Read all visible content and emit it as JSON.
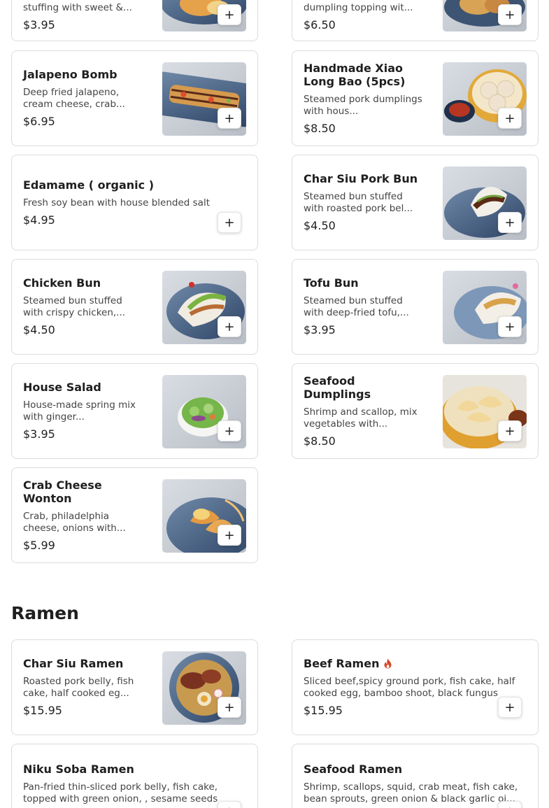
{
  "add_label": "+",
  "sections": {
    "ramen_title": "Ramen"
  },
  "items": {
    "top_left": {
      "desc": "stuffing with sweet &...",
      "price": "$3.95"
    },
    "top_right": {
      "desc": "dumpling topping wit...",
      "price": "$6.50"
    },
    "jalapeno": {
      "name": "Jalapeno Bomb",
      "desc": "Deep fried jalapeno, cream cheese, crab...",
      "price": "$6.95"
    },
    "xiaolongbao": {
      "name": "Handmade Xiao Long Bao (5pcs)",
      "desc": "Steamed pork dumplings with hous...",
      "price": "$8.50"
    },
    "edamame": {
      "name": "Edamame ( organic )",
      "desc": "Fresh soy bean with house blended salt",
      "price": "$4.95"
    },
    "charsiu_bun": {
      "name": "Char Siu Pork Bun",
      "desc": "Steamed bun stuffed with roasted pork bel...",
      "price": "$4.50"
    },
    "chicken_bun": {
      "name": "Chicken Bun",
      "desc": "Steamed bun stuffed with crispy chicken,...",
      "price": "$4.50"
    },
    "tofu_bun": {
      "name": "Tofu Bun",
      "desc": "Steamed bun stuffed with deep-fried tofu,...",
      "price": "$3.95"
    },
    "house_salad": {
      "name": "House Salad",
      "desc": "House-made spring mix with ginger...",
      "price": "$3.95"
    },
    "seafood_dumplings": {
      "name": "Seafood Dumplings",
      "desc": "Shrimp and scallop, mix vegetables with...",
      "price": "$8.50"
    },
    "crab_wonton": {
      "name": "Crab Cheese Wonton",
      "desc": "Crab, philadelphia cheese, onions with...",
      "price": "$5.99"
    },
    "charsiu_ramen": {
      "name": "Char Siu Ramen",
      "desc": "Roasted pork belly, fish cake, half cooked eg...",
      "price": "$15.95"
    },
    "beef_ramen": {
      "name": "Beef Ramen",
      "desc": "Sliced beef,spicy ground pork, fish cake, half cooked egg, bamboo shoot, black fungus",
      "price": "$15.95",
      "icon": "spicy-flame-icon"
    },
    "niku_soba": {
      "name": "Niku Soba Ramen",
      "desc": "Pan-fried thin-sliced pork belly, fish cake, topped with green onion, , sesame seeds"
    },
    "seafood_ramen": {
      "name": "Seafood Ramen",
      "desc": "Shrimp, scallops, squid, crab meat, fish cake, bean sprouts, green onion & black garlic oi..."
    }
  },
  "colors": {
    "card_border": "#dcdcdc",
    "spicy": "#d64a2a"
  }
}
